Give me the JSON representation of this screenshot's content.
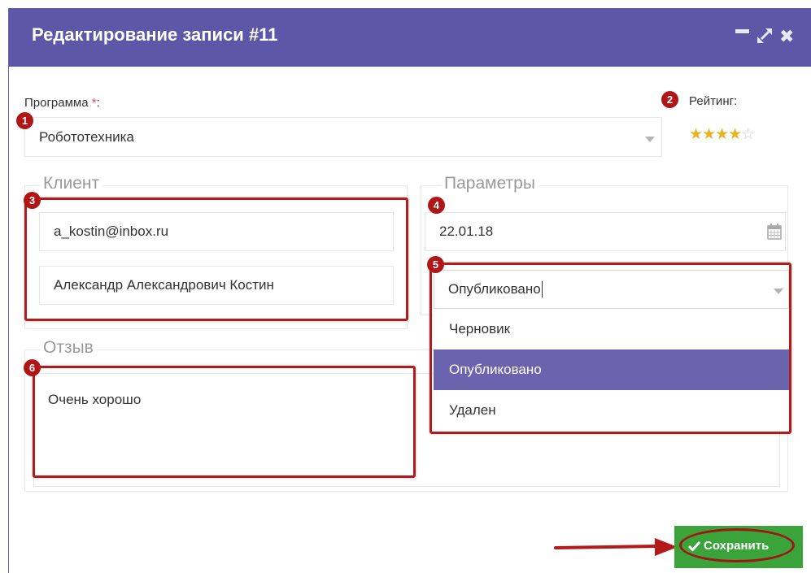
{
  "dialog": {
    "title": "Редактирование записи #11",
    "controls": {
      "minimize_icon": "minimize-icon",
      "maximize_icon": "maximize-icon",
      "close_glyph": "✖"
    }
  },
  "program": {
    "label": "Программа",
    "required_mark": "*",
    "colon": ":",
    "value": "Робототехника"
  },
  "rating": {
    "label": "Рейтинг:",
    "stars_filled": 4,
    "stars_total": 5,
    "filled_glyphs": "★★★★",
    "empty_glyphs": "☆"
  },
  "client": {
    "legend": "Клиент",
    "email": "a_kostin@inbox.ru",
    "name": "Александр Александрович Костин"
  },
  "params": {
    "legend": "Параметры",
    "date": "22.01.18",
    "status_value": "Опубликовано",
    "status_options": [
      "Черновик",
      "Опубликовано",
      "Удален"
    ],
    "selected_option": "Опубликовано"
  },
  "review": {
    "legend": "Отзыв",
    "text": "Очень хорошо"
  },
  "badges": [
    "1",
    "2",
    "3",
    "4",
    "5",
    "6"
  ],
  "save_button": {
    "label": "Сохранить",
    "icon": "check-icon"
  },
  "colors": {
    "titlebar": "#5e57a8",
    "highlight_red": "#b31b1b",
    "selected_option": "#6b63ae",
    "save_green": "#3aa339",
    "star": "#e6b422"
  }
}
